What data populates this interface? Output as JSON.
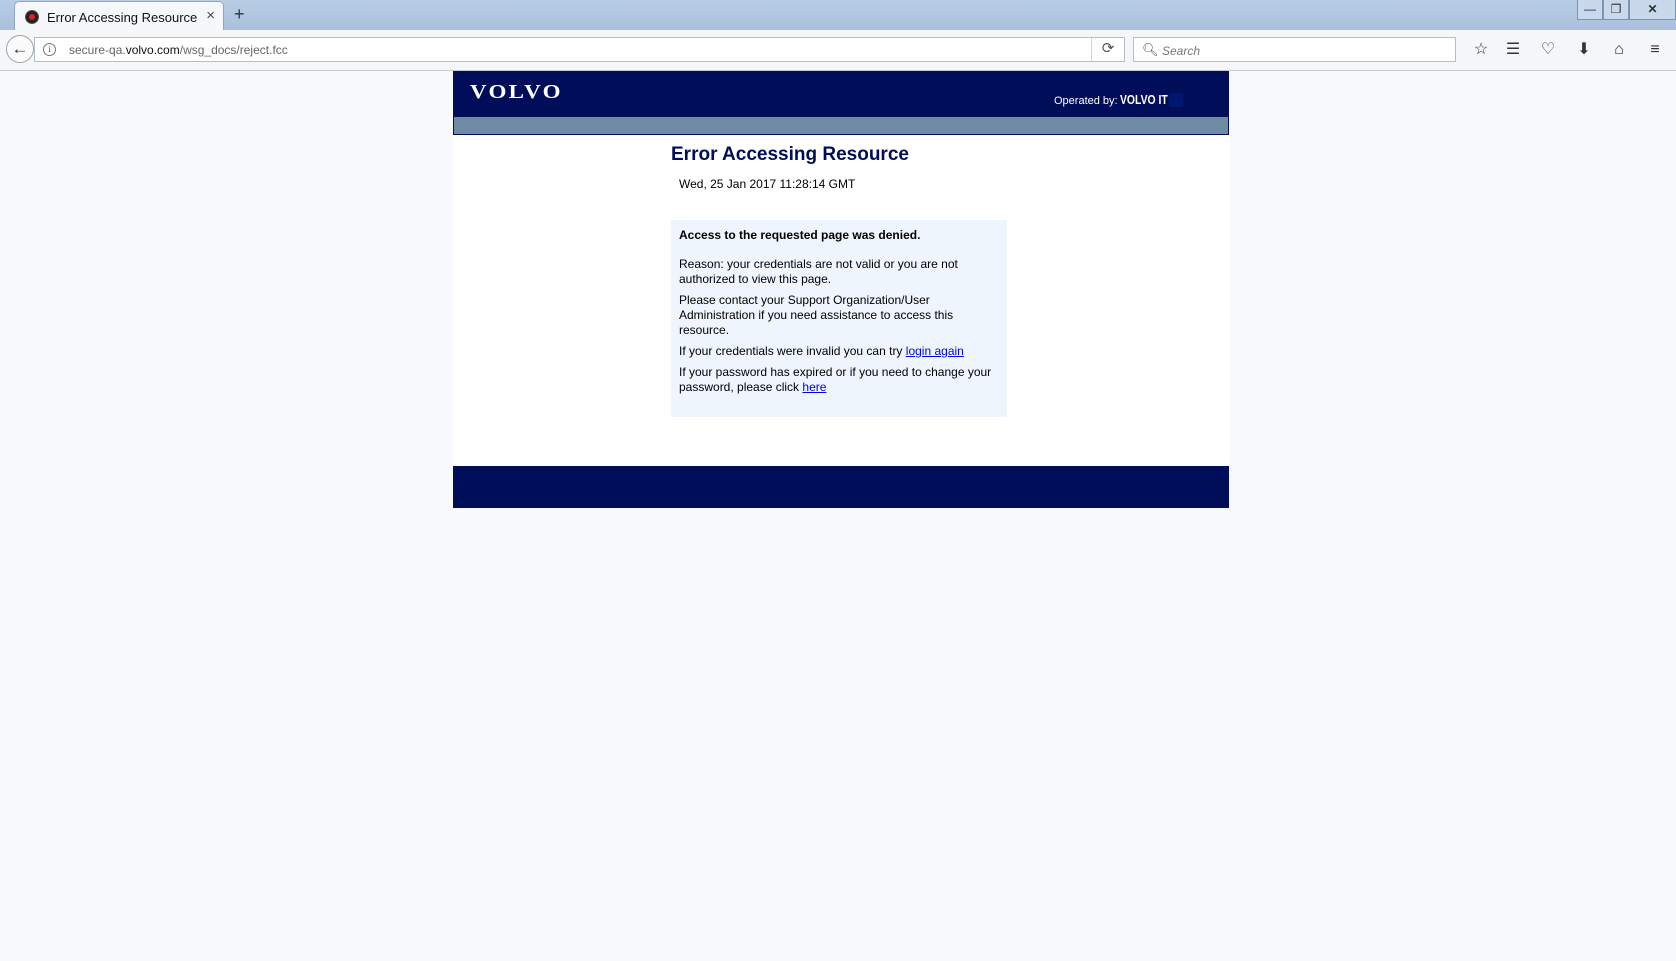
{
  "browser": {
    "tab_title": "Error Accessing Resource",
    "tab_close": "×",
    "new_tab": "+",
    "url_prefix": "secure-qa.",
    "url_domain": "volvo.com",
    "url_path": "/wsg_docs/reject.fcc",
    "search_placeholder": "Search",
    "window_controls": {
      "minimize": "—",
      "maximize": "❐",
      "close": "✕"
    },
    "icons": [
      "back-icon",
      "info-icon",
      "reload-icon",
      "search-icon",
      "bookmark-star-icon",
      "reading-list-icon",
      "pocket-icon",
      "download-icon",
      "home-icon",
      "menu-icon"
    ]
  },
  "page": {
    "logo_text": "VOLVO",
    "operated_by": "Operated by:",
    "operator": "VOLVO IT",
    "error_title": "Error Accessing Resource",
    "error_date": "Wed, 25 Jan 2017 11:28:14 GMT",
    "message": {
      "denied": "Access to the requested page was denied.",
      "reason": "Reason: your credentials are not valid or you are not authorized to view this page.",
      "contact": "Please contact your Support Organization/User Administration if you need assistance to access this resource.",
      "invalid_prefix": "If your credentials were invalid you can try ",
      "login_link": "login again",
      "expired_prefix": "If your password has expired or if you need to change your password, please click ",
      "here_link": "here"
    }
  },
  "colors": {
    "header_navy": "#000e5a",
    "grey_bar": "#6f8aa3",
    "message_bg": "#eef5fc",
    "link": "#0000ee"
  }
}
